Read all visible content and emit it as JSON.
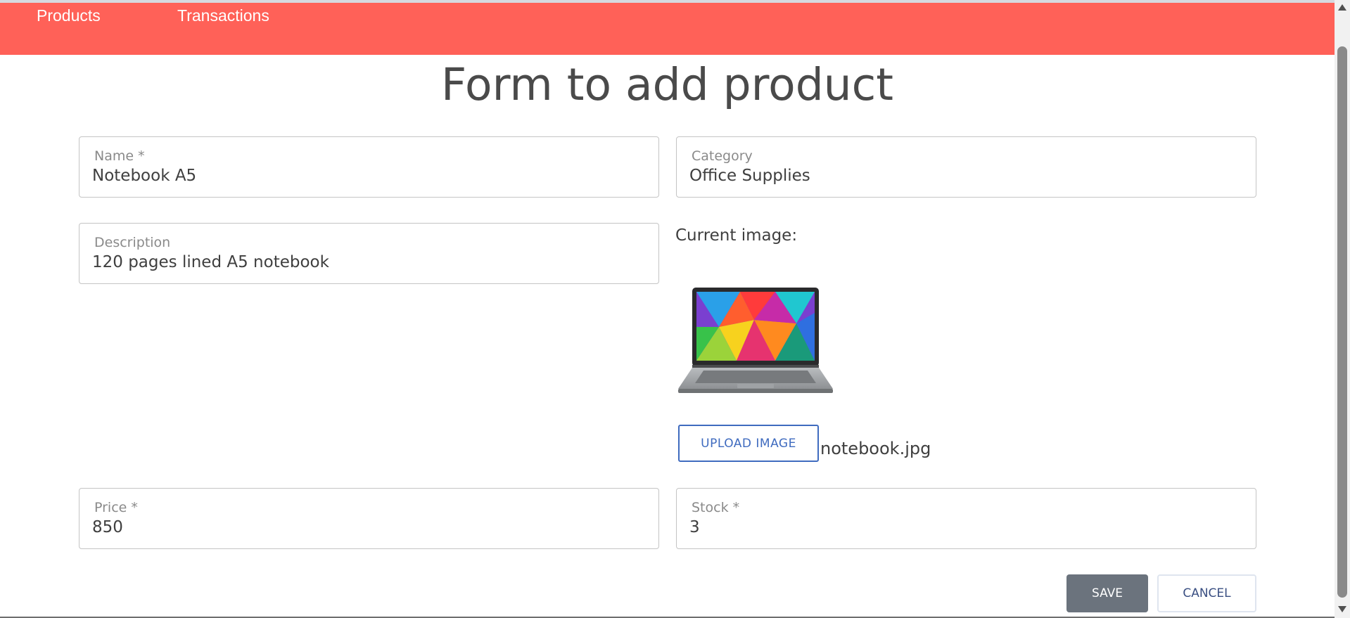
{
  "nav": {
    "products": "Products",
    "transactions": "Transactions"
  },
  "form": {
    "title": "Form to add product",
    "name": {
      "label": "Name *",
      "value": "Notebook A5"
    },
    "category": {
      "label": "Category",
      "value": "Office Supplies"
    },
    "description": {
      "label": "Description",
      "value": "120 pages lined A5 notebook"
    },
    "current_image_label": "Current image:",
    "upload_label": "UPLOAD IMAGE",
    "file_name": "notebook.jpg",
    "price": {
      "label": "Price *",
      "value": "850"
    },
    "stock": {
      "label": "Stock *",
      "value": "3"
    },
    "save_label": "SAVE",
    "cancel_label": "CANCEL"
  },
  "colors": {
    "navbar": "#ff6158",
    "upload_accent": "#3f6bbf",
    "save_bg": "#6b737d"
  }
}
